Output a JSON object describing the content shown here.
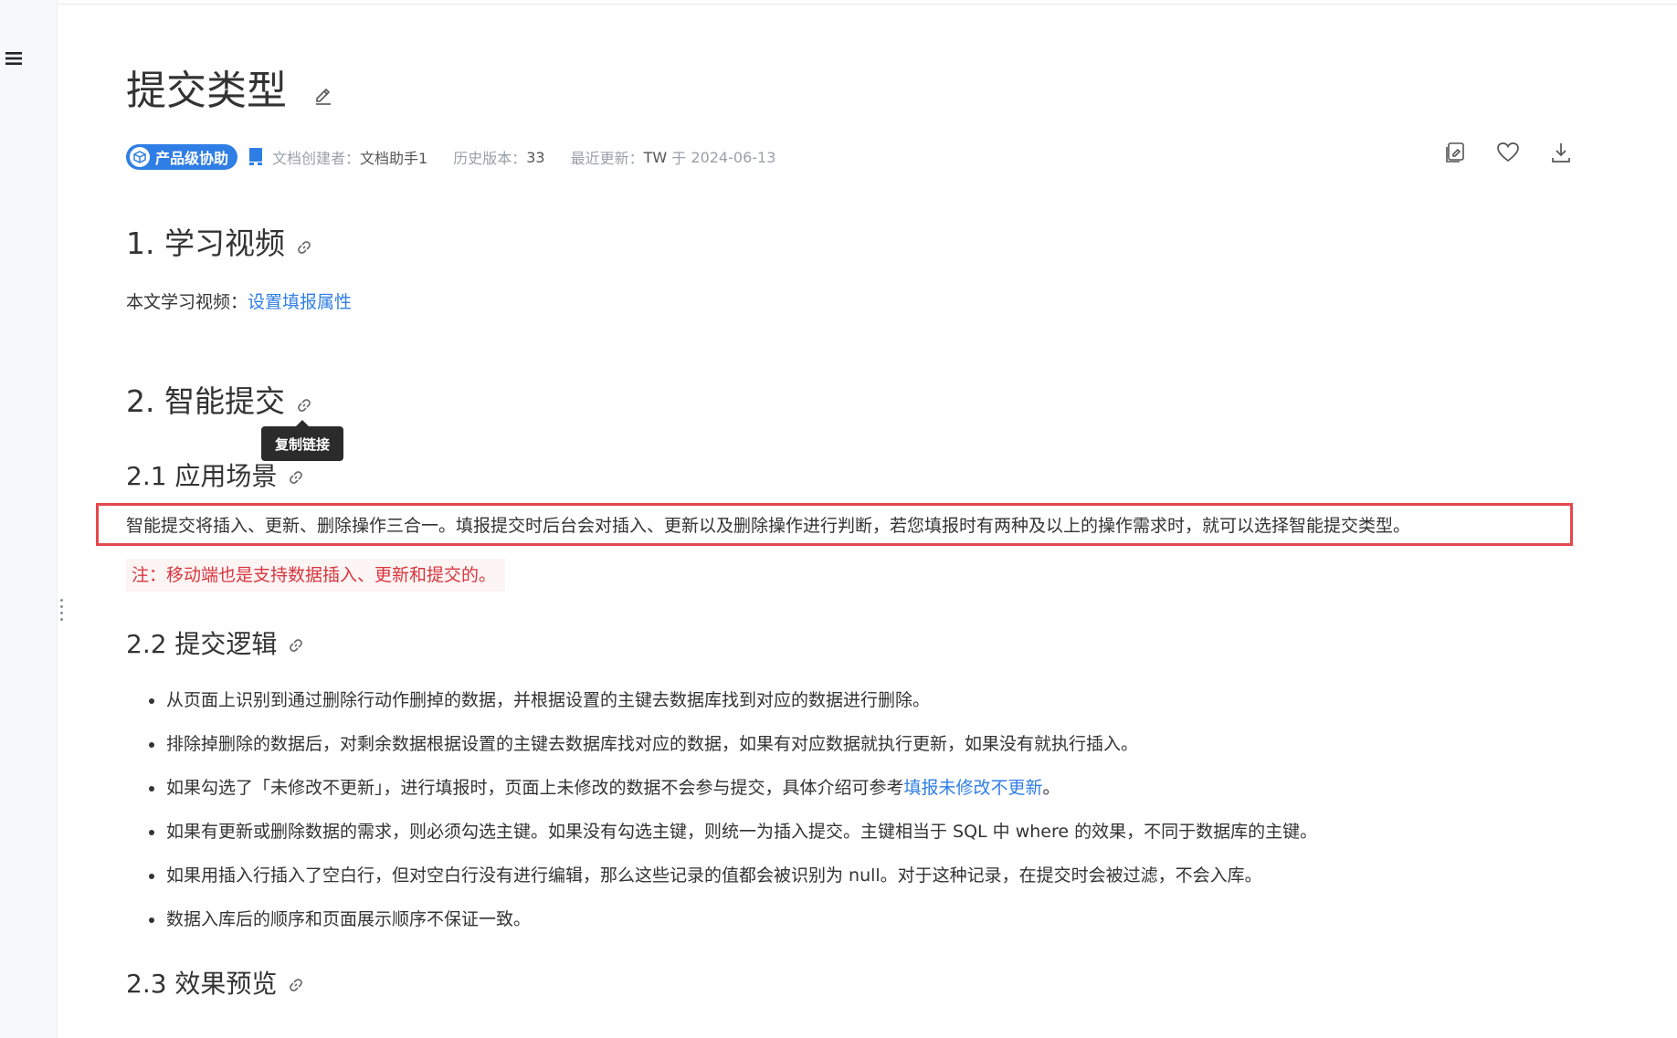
{
  "page": {
    "title": "提交类型",
    "badge": "产品级协助",
    "meta": {
      "creator_label": "文档创建者：",
      "creator": "文档助手1",
      "version_label": "历史版本：",
      "version": "33",
      "updated_label": "最近更新：",
      "updated_by": "TW",
      "updated_sep": " 于 ",
      "updated_date": "2024-06-13"
    }
  },
  "sections": {
    "s1": {
      "heading": "1. 学习视频",
      "text": "本文学习视频：",
      "link": "设置填报属性"
    },
    "s2": {
      "heading": "2. 智能提交",
      "tooltip": "复制链接",
      "s21": {
        "heading": "2.1 应用场景",
        "text": "智能提交将插入、更新、删除操作三合一。填报提交时后台会对插入、更新以及删除操作进行判断，若您填报时有两种及以上的操作需求时，就可以选择智能提交类型。",
        "note": "注：移动端也是支持数据插入、更新和提交的。"
      },
      "s22": {
        "heading": "2.2 提交逻辑",
        "items": [
          "从页面上识别到通过删除行动作删掉的数据，并根据设置的主键去数据库找到对应的数据进行删除。",
          "排除掉删除的数据后，对剩余数据根据设置的主键去数据库找对应的数据，如果有对应数据就执行更新，如果没有就执行插入。",
          "如果勾选了「未修改不更新」，进行填报时，页面上未修改的数据不会参与提交，具体介绍可参考",
          "如果有更新或删除数据的需求，则必须勾选主键。如果没有勾选主键，则统一为插入提交。主键相当于 SQL 中 where 的效果，不同于数据库的主键。",
          "如果用插入行插入了空白行，但对空白行没有进行编辑，那么这些记录的值都会被识别为 null。对于这种记录，在提交时会被过滤，不会入库。",
          "数据入库后的顺序和页面展示顺序不保证一致。"
        ],
        "item3_link": "填报未修改不更新",
        "item3_end": "。"
      },
      "s23": {
        "heading": "2.3 效果预览"
      }
    }
  },
  "icons": {
    "menu": "menu-icon",
    "edit": "edit-icon",
    "anchor": "link-icon",
    "actions": [
      "copy-edit-icon",
      "heart-icon",
      "download-icon"
    ]
  },
  "colors": {
    "accent": "#2f7ee6",
    "highlight_border": "#e5484d",
    "note_text": "#d9363e",
    "note_bg": "#fdf4f4"
  }
}
